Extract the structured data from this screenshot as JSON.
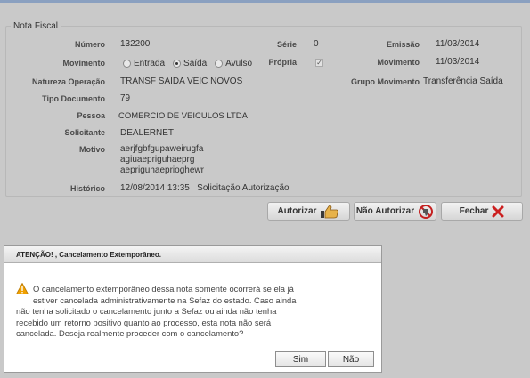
{
  "form": {
    "legend": "Nota Fiscal",
    "numero_label": "Número",
    "numero_value": "132200",
    "serie_label": "Série",
    "serie_value": "0",
    "emissao_label": "Emissão",
    "emissao_value": "11/03/2014",
    "movimento_label": "Movimento",
    "radio_entrada": "Entrada",
    "radio_saida": "Saída",
    "radio_avulso": "Avulso",
    "radio_selected": "Saída",
    "propria_label": "Própria",
    "propria_checked": true,
    "movimento_date_label": "Movimento",
    "movimento_date_value": "11/03/2014",
    "natureza_label": "Natureza Operação",
    "natureza_value": "TRANSF SAIDA VEIC NOVOS",
    "grupo_label": "Grupo Movimento",
    "grupo_value": "Transferência Saída",
    "tipo_label": "Tipo Documento",
    "tipo_value": "79",
    "pessoa_label": "Pessoa",
    "pessoa_value": "COMERCIO DE VEICULOS LTDA",
    "solicitante_label": "Solicitante",
    "solicitante_value": "DEALERNET",
    "motivo_label": "Motivo",
    "motivo_line1": "aerjfgbfgupaweirugfa",
    "motivo_line2": "agiuaepriguhaeprg",
    "motivo_line3": "aepriguhaeprioghewr",
    "historico_label": "Histórico",
    "historico_value": "12/08/2014 13:35   Solicitação Autorização"
  },
  "actions": {
    "autorizar": "Autorizar",
    "nao_autorizar": "Não Autorizar",
    "fechar": "Fechar"
  },
  "dialog": {
    "title": "ATENÇÃO! , Cancelamento Extemporâneo.",
    "message": "O cancelamento extemporâneo dessa nota somente ocorrerá se ela já estiver cancelada administrativamente na Sefaz do estado. Caso ainda não tenha solicitado o cancelamento junto a Sefaz ou ainda não tenha recebido um retorno positivo quanto ao processo, esta nota não será cancelada. Deseja realmente proceder com o cancelamento?",
    "line1": "O cancelamento extemporâneo dessa nota somente ocorrerá se ela já",
    "line2": "estiver cancelada administrativamente na Sefaz do estado. Caso ainda",
    "line3": "não tenha solicitado o cancelamento junto a Sefaz ou ainda não tenha",
    "line4": "recebido um retorno positivo quanto ao processo, esta nota não será",
    "line5": "cancelada. Deseja realmente proceder com o cancelamento?",
    "yes": "Sim",
    "no": "Não"
  },
  "icons": {
    "warning": "warning-icon",
    "thumbs_up": "thumbs-up-icon",
    "thumbs_down": "thumbs-down-icon",
    "close": "close-icon"
  },
  "colors": {
    "background": "#c9c9c9",
    "warning": "#f0a000",
    "close_red": "#cc1f1f",
    "topbar": "#8aa0c0"
  }
}
